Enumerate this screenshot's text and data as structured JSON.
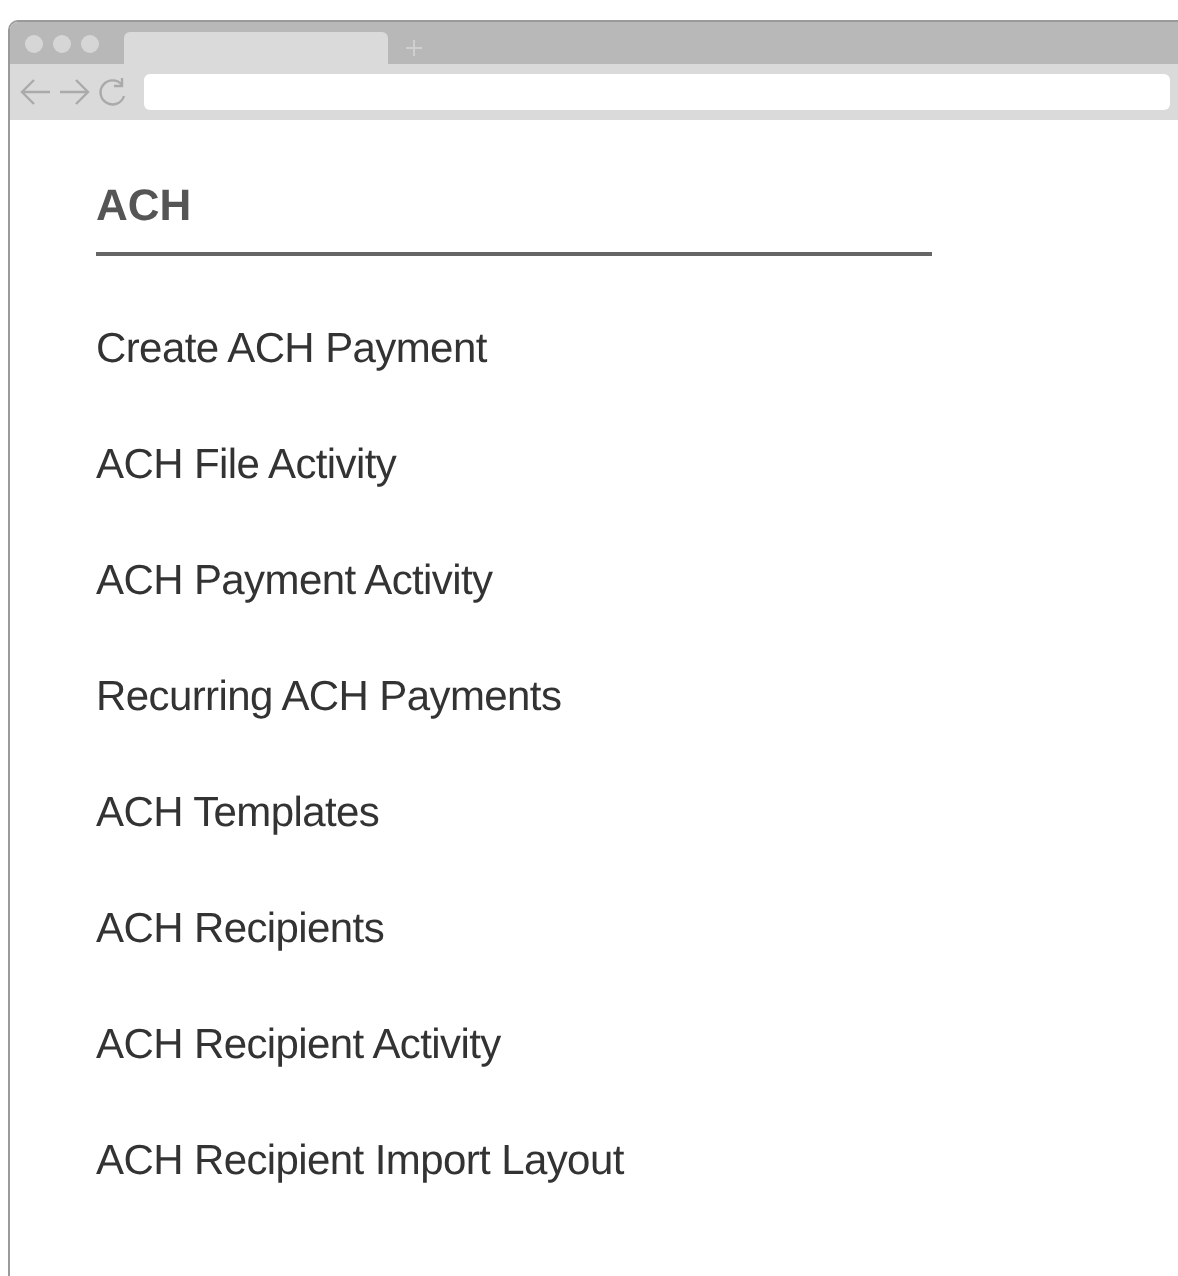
{
  "menu": {
    "heading": "ACH",
    "items": [
      {
        "label": "Create ACH Payment"
      },
      {
        "label": "ACH File Activity"
      },
      {
        "label": "ACH Payment Activity"
      },
      {
        "label": "Recurring ACH Payments"
      },
      {
        "label": "ACH Templates"
      },
      {
        "label": "ACH Recipients"
      },
      {
        "label": "ACH Recipient Activity"
      },
      {
        "label": "ACH Recipient Import Layout"
      }
    ]
  }
}
